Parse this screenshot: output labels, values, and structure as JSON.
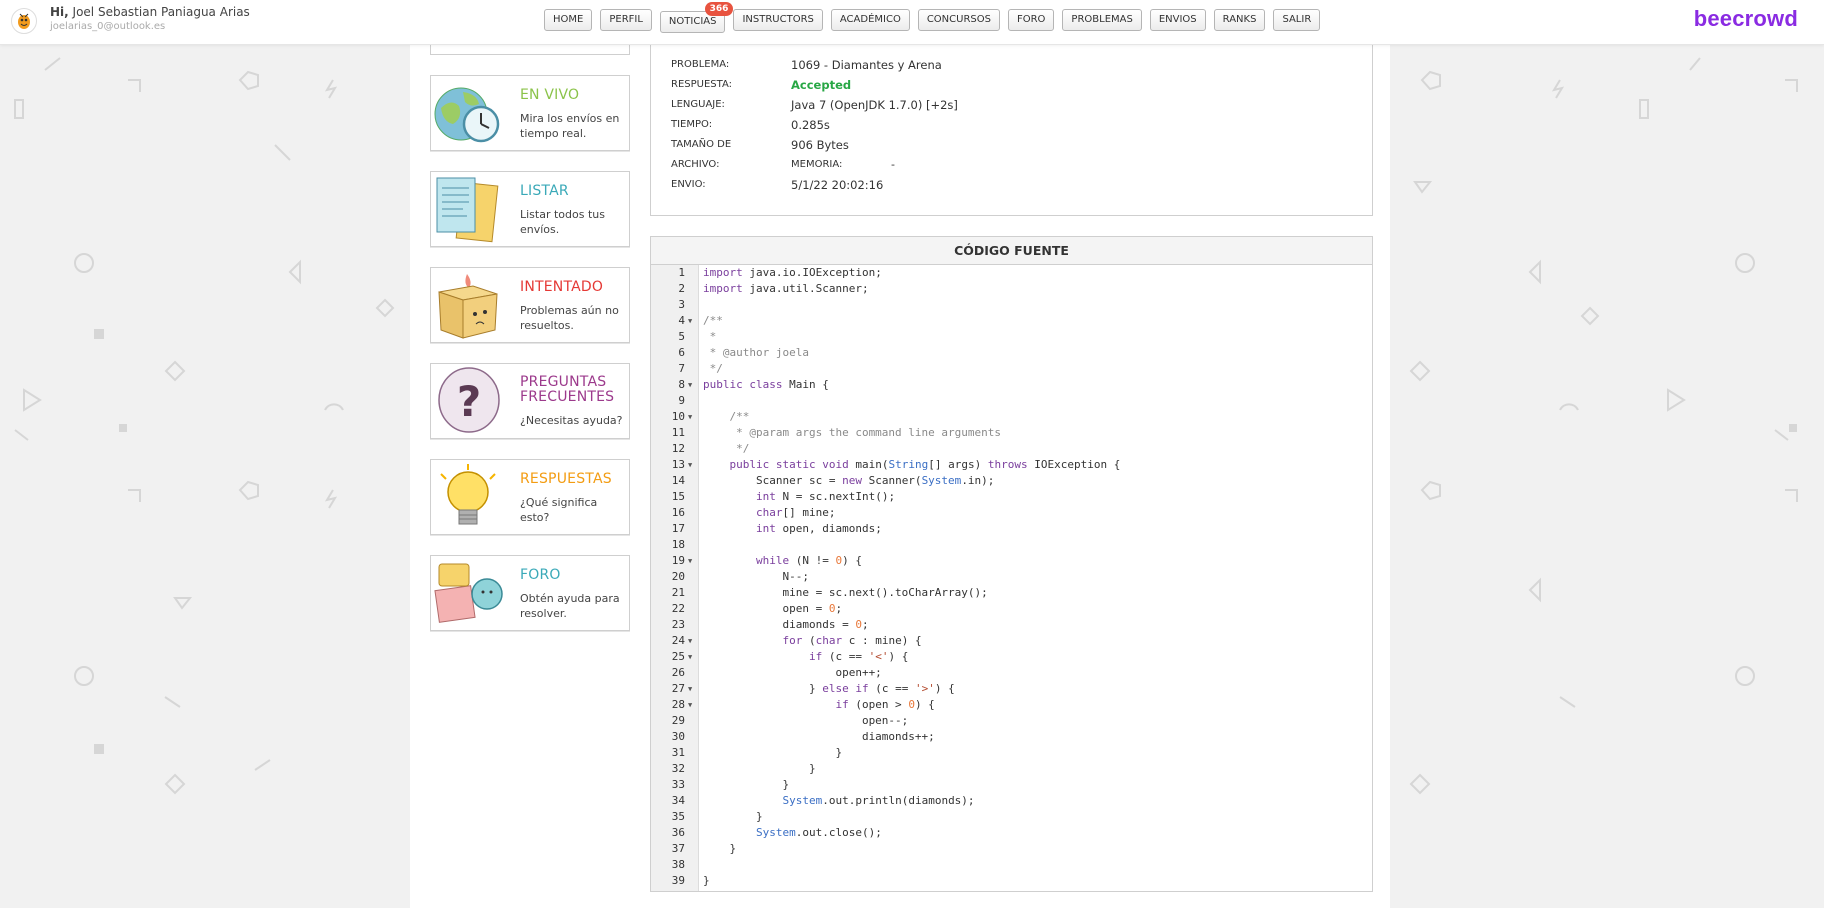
{
  "header": {
    "greeting_prefix": "Hi,",
    "user_name": "Joel Sebastian Paniagua Arias",
    "user_email": "joelarias_0@outlook.es",
    "logo": "beecrowd",
    "nav": [
      {
        "label": "HOME"
      },
      {
        "label": "PERFIL"
      },
      {
        "label": "NOTICIAS",
        "badge": "366"
      },
      {
        "label": "INSTRUCTORS"
      },
      {
        "label": "ACADÉMICO"
      },
      {
        "label": "CONCURSOS"
      },
      {
        "label": "FORO"
      },
      {
        "label": "PROBLEMAS"
      },
      {
        "label": "ENVIOS"
      },
      {
        "label": "RANKS"
      },
      {
        "label": "SALIR"
      }
    ]
  },
  "sidebar": {
    "cards": [
      {
        "title": "EN VIVO",
        "desc": "Mira los envíos en tiempo real.",
        "color": "#8bc34a",
        "icon": "globe-clock-icon"
      },
      {
        "title": "LISTAR",
        "desc": "Listar todos tus envíos.",
        "color": "#3aa9b8",
        "icon": "document-list-icon"
      },
      {
        "title": "INTENTADO",
        "desc": "Problemas aún no resueltos.",
        "color": "#e53935",
        "icon": "box-icon"
      },
      {
        "title": "PREGUNTAS FRECUENTES",
        "desc": "¿Necesitas ayuda?",
        "color": "#9c3a8c",
        "icon": "question-bubble-icon"
      },
      {
        "title": "RESPUESTAS",
        "desc": "¿Qué significa esto?",
        "color": "#f39c12",
        "icon": "lightbulb-icon"
      },
      {
        "title": "FORO",
        "desc": "Obtén ayuda para resolver.",
        "color": "#3aa9b8",
        "icon": "forum-chat-icon"
      }
    ]
  },
  "submission": {
    "problem_label": "PROBLEMA:",
    "problem_value": "1069 - Diamantes y Arena",
    "answer_label": "RESPUESTA:",
    "answer_value": "Accepted",
    "language_label": "LENGUAJE:",
    "language_value": "Java 7 (OpenJDK 1.7.0) [+2s]",
    "time_label": "TIEMPO:",
    "time_value": "0.285s",
    "size_label": "TAMAÑO DE",
    "size_value": "906 Bytes",
    "file_label": "ARCHIVO:",
    "memory_label": "MEMORIA:",
    "memory_value": "-",
    "sent_label": "ENVIO:",
    "sent_value": "5/1/22 20:02:16"
  },
  "code": {
    "title": "CÓDIGO FUENTE",
    "fold_lines": [
      4,
      8,
      10,
      13,
      19,
      24,
      25,
      27,
      28
    ],
    "lines": [
      "import java.io.IOException;",
      "import java.util.Scanner;",
      "",
      "/**",
      " *",
      " * @author joela",
      " */",
      "public class Main {",
      "",
      "    /**",
      "     * @param args the command line arguments",
      "     */",
      "    public static void main(String[] args) throws IOException {",
      "        Scanner sc = new Scanner(System.in);",
      "        int N = sc.nextInt();",
      "        char[] mine;",
      "        int open, diamonds;",
      "",
      "        while (N != 0) {",
      "            N--;",
      "            mine = sc.next().toCharArray();",
      "            open = 0;",
      "            diamonds = 0;",
      "            for (char c : mine) {",
      "                if (c == '<') {",
      "                    open++;",
      "                } else if (c == '>') {",
      "                    if (open > 0) {",
      "                        open--;",
      "                        diamonds++;",
      "                    }",
      "                }",
      "            }",
      "            System.out.println(diamonds);",
      "        }",
      "        System.out.close();",
      "    }",
      "",
      "}"
    ]
  }
}
